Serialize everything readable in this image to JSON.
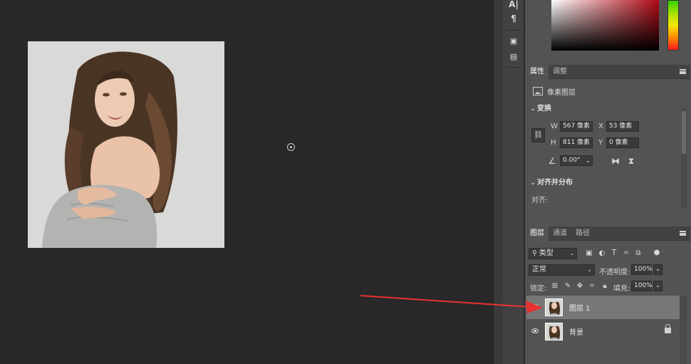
{
  "properties_panel": {
    "tabs": [
      {
        "label": "属性",
        "active": true
      },
      {
        "label": "调整",
        "active": false
      }
    ],
    "layer_kind": "像素图层",
    "transform": {
      "title": "变换",
      "w_label": "W",
      "w_value": "567 像素",
      "x_label": "X",
      "x_value": "53 像素",
      "h_label": "H",
      "h_value": "811 像素",
      "y_label": "Y",
      "y_value": "0 像素",
      "angle_value": "0.00°"
    },
    "align": {
      "title": "对齐并分布",
      "label": "对齐:"
    }
  },
  "layers_panel": {
    "tabs": [
      {
        "label": "图层",
        "active": true
      },
      {
        "label": "通道",
        "active": false
      },
      {
        "label": "路径",
        "active": false
      }
    ],
    "filter_kind": "类型",
    "blend_mode": "正常",
    "opacity_label": "不透明度:",
    "opacity_value": "100%",
    "lock_label": "锁定:",
    "fill_label": "填充:",
    "fill_value": "100%",
    "layers": [
      {
        "name": "图层 1",
        "selected": true,
        "locked": false
      },
      {
        "name": "背景",
        "selected": false,
        "locked": true
      }
    ]
  },
  "colors": {
    "accent_arrow": "#e8322f",
    "selected_row": "#777777"
  }
}
